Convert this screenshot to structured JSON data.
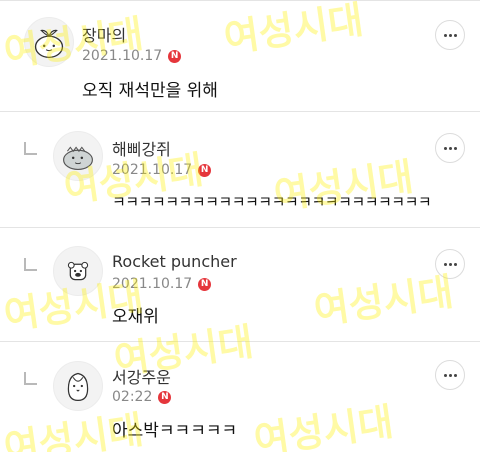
{
  "comments": [
    {
      "nickname": "장마의",
      "date": "2021.10.17",
      "new_badge": "N",
      "text": "오직 재석만을 위해",
      "is_reply": false,
      "avatar_icon": "sprout-character-icon"
    },
    {
      "nickname": "해삐강쥐",
      "date": "2021.10.17",
      "new_badge": "N",
      "text": "ㅋㅋㅋㅋㅋㅋㅋㅋㅋㅋㅋㅋㅋㅋㅋㅋㅋㅋㅋㅋㅋㅋㅋㅋ",
      "is_reply": true,
      "avatar_icon": "dinosaur-character-icon"
    },
    {
      "nickname": "Rocket puncher",
      "date": "2021.10.17",
      "new_badge": "N",
      "text": "오재위",
      "is_reply": true,
      "avatar_icon": "bear-character-icon"
    },
    {
      "nickname": "서강주운",
      "date": "02:22",
      "new_badge": "N",
      "text": "아스박ㅋㅋㅋㅋㅋ",
      "is_reply": true,
      "avatar_icon": "penguin-character-icon"
    }
  ],
  "watermark": "여성시대",
  "colors": {
    "badge": "#e5363c",
    "watermark": "#fff000",
    "divider": "#e4e4e4"
  }
}
